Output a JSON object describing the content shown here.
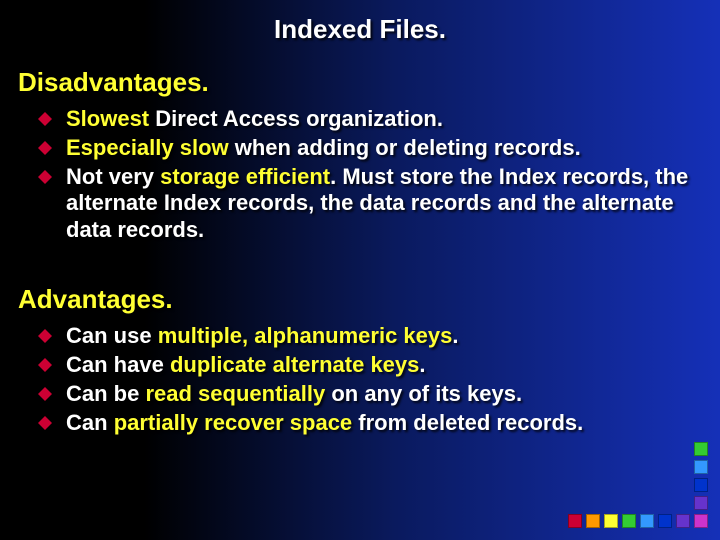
{
  "title": "Indexed Files.",
  "headings": {
    "disadvantages": "Disadvantages.",
    "advantages": "Advantages."
  },
  "disadvantages": [
    {
      "seg": [
        {
          "t": "Slowest",
          "y": true
        },
        {
          "t": " Direct Access organization.",
          "y": false
        }
      ]
    },
    {
      "seg": [
        {
          "t": "Especially slow",
          "y": true
        },
        {
          "t": "  when adding or deleting records.",
          "y": false
        }
      ]
    },
    {
      "seg": [
        {
          "t": "Not",
          "y": false
        },
        {
          "t": " very ",
          "y": false
        },
        {
          "t": "storage efficient",
          "y": true
        },
        {
          "t": ".  Must store the Index records, the alternate Index records, the data records and the alternate data records.",
          "y": false
        }
      ]
    }
  ],
  "advantages": [
    {
      "seg": [
        {
          "t": "Can use ",
          "y": false
        },
        {
          "t": "multiple, alphanumeric keys",
          "y": true
        },
        {
          "t": ".",
          "y": false
        }
      ]
    },
    {
      "seg": [
        {
          "t": "Can have ",
          "y": false
        },
        {
          "t": "duplicate alternate keys",
          "y": true
        },
        {
          "t": ".",
          "y": false
        }
      ]
    },
    {
      "seg": [
        {
          "t": "Can be ",
          "y": false
        },
        {
          "t": "read sequentially",
          "y": true
        },
        {
          "t": " on any of its keys.",
          "y": false
        }
      ]
    },
    {
      "seg": [
        {
          "t": "Can ",
          "y": false
        },
        {
          "t": "partially recover space",
          "y": true
        },
        {
          "t": " from deleted records.",
          "y": false
        }
      ]
    }
  ],
  "colors": {
    "bullet": "#cc0033",
    "highlight": "#ffff33",
    "deco": [
      "#cc0033",
      "#ff9900",
      "#ffff33",
      "#33cc33",
      "#3399ff",
      "#0033cc",
      "#6633cc",
      "#cc33cc"
    ]
  }
}
